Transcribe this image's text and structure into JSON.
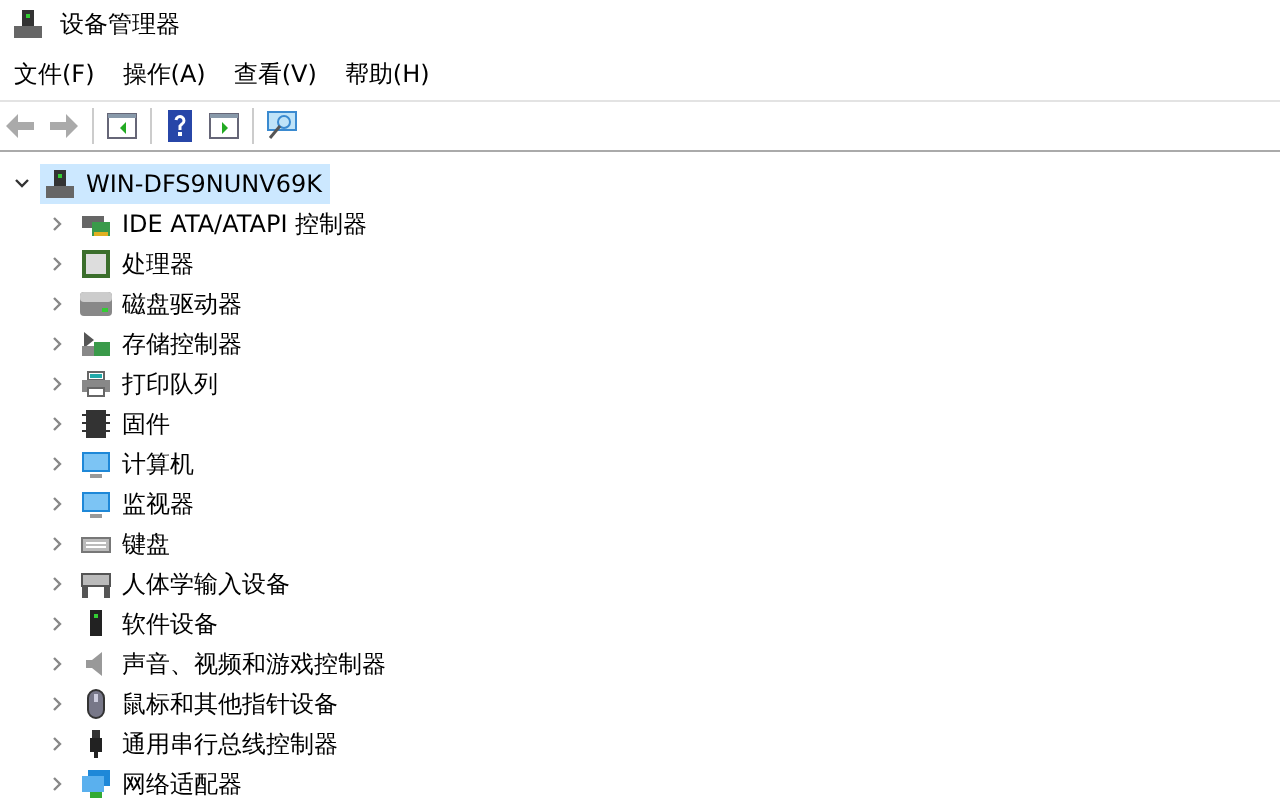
{
  "window": {
    "title": "设备管理器"
  },
  "menu": [
    {
      "label": "文件(F)"
    },
    {
      "label": "操作(A)"
    },
    {
      "label": "查看(V)"
    },
    {
      "label": "帮助(H)"
    }
  ],
  "toolbar": [
    {
      "kind": "back",
      "disabled": true
    },
    {
      "kind": "forward",
      "disabled": true
    },
    {
      "kind": "sep"
    },
    {
      "kind": "pane",
      "disabled": false
    },
    {
      "kind": "sep"
    },
    {
      "kind": "help",
      "disabled": false
    },
    {
      "kind": "pane2",
      "disabled": false
    },
    {
      "kind": "sep"
    },
    {
      "kind": "scan",
      "disabled": false
    }
  ],
  "tree": {
    "label": "WIN-DFS9NUNV69K",
    "expanded": true,
    "selected": true,
    "children": [
      {
        "label": "IDE ATA/ATAPI 控制器",
        "expanded": false,
        "selected": false
      },
      {
        "label": "处理器",
        "expanded": false,
        "selected": false
      },
      {
        "label": "磁盘驱动器",
        "expanded": false,
        "selected": false
      },
      {
        "label": "存储控制器",
        "expanded": false,
        "selected": false
      },
      {
        "label": "打印队列",
        "expanded": false,
        "selected": false
      },
      {
        "label": "固件",
        "expanded": false,
        "selected": false
      },
      {
        "label": "计算机",
        "expanded": false,
        "selected": false
      },
      {
        "label": "监视器",
        "expanded": false,
        "selected": false
      },
      {
        "label": "键盘",
        "expanded": false,
        "selected": false
      },
      {
        "label": "人体学输入设备",
        "expanded": false,
        "selected": false
      },
      {
        "label": "软件设备",
        "expanded": false,
        "selected": false
      },
      {
        "label": "声音、视频和游戏控制器",
        "expanded": false,
        "selected": false
      },
      {
        "label": "鼠标和其他指针设备",
        "expanded": false,
        "selected": false
      },
      {
        "label": "通用串行总线控制器",
        "expanded": false,
        "selected": false
      },
      {
        "label": "网络适配器",
        "expanded": false,
        "selected": false
      }
    ]
  }
}
